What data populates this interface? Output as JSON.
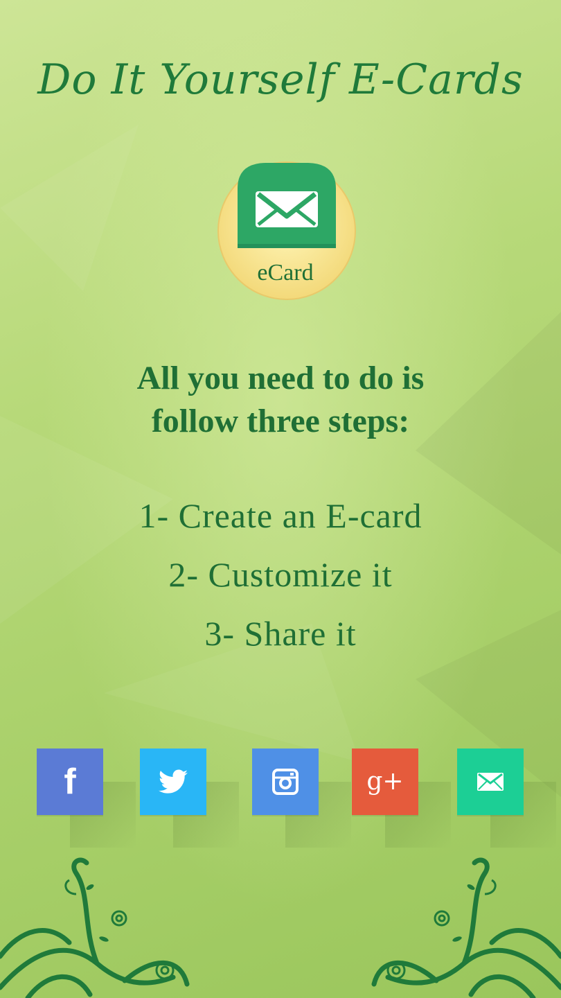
{
  "header": {
    "title": "Do It Yourself E-Cards"
  },
  "logo": {
    "label": "eCard",
    "icon": "envelope-icon"
  },
  "intro": {
    "line1": "All you need to do is",
    "line2": "follow three steps:"
  },
  "steps": [
    "1- Create an E-card",
    "2- Customize it",
    "3- Share it"
  ],
  "share_buttons": [
    {
      "name": "facebook",
      "icon": "facebook-icon",
      "glyph": "f",
      "color": "#5b7bd5"
    },
    {
      "name": "twitter",
      "icon": "twitter-icon",
      "glyph": "",
      "color": "#29b6f6"
    },
    {
      "name": "instagram",
      "icon": "instagram-icon",
      "glyph": "",
      "color": "#4f90e6"
    },
    {
      "name": "google-plus",
      "icon": "google-plus-icon",
      "glyph": "g+",
      "color": "#e55b3c"
    },
    {
      "name": "email",
      "icon": "email-icon",
      "glyph": "",
      "color": "#1ccf95"
    }
  ],
  "colors": {
    "text_green": "#1f6f35",
    "background": "#b7d979"
  }
}
